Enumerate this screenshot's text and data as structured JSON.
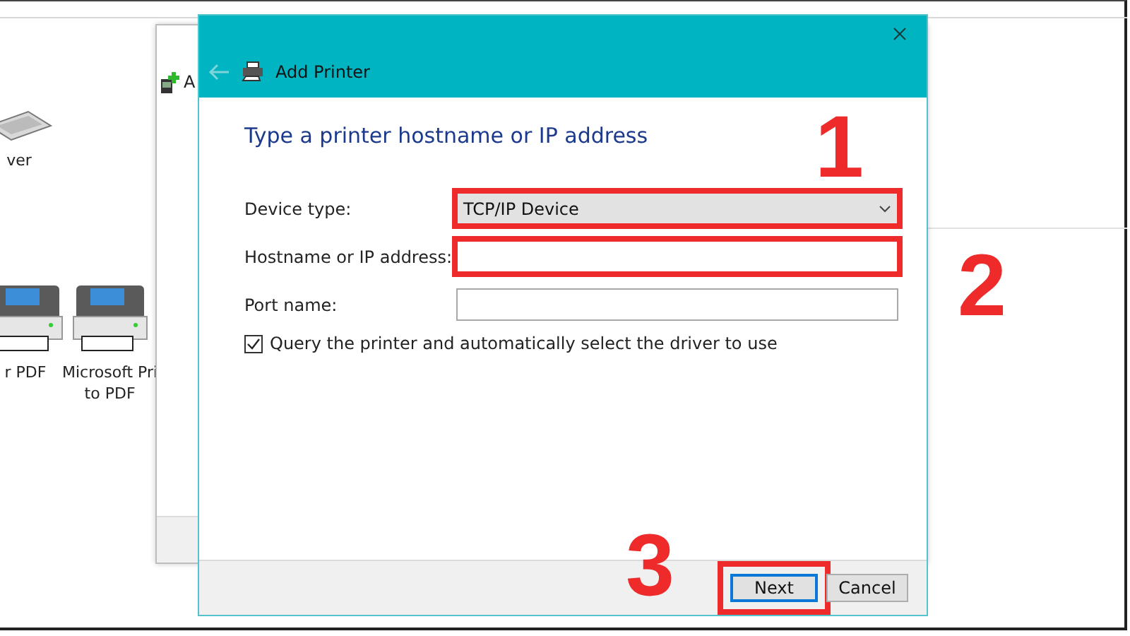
{
  "explorer": {
    "devices": [
      {
        "kind": "keyboard",
        "lines": [
          "ver"
        ]
      },
      {
        "kind": "printer",
        "lines": [
          "r PDF"
        ]
      },
      {
        "kind": "printer",
        "lines": [
          "Microsoft Pri",
          "to PDF"
        ]
      }
    ]
  },
  "back_dialog": {
    "title": "A"
  },
  "dialog": {
    "title": "Add Printer",
    "heading": "Type a printer hostname or IP address",
    "fields": [
      {
        "kind": "dropdown",
        "label": "Device type:",
        "value": "TCP/IP Device",
        "highlighted": true
      },
      {
        "kind": "text",
        "label": "Hostname or IP address:",
        "highlighted": true
      },
      {
        "kind": "text",
        "label": "Port name:",
        "highlighted": false
      }
    ],
    "checkbox": {
      "label": "Query the printer and automatically select the driver to use",
      "checked": true
    },
    "buttons": [
      {
        "label": "Next",
        "kind": "primary",
        "highlighted": true
      },
      {
        "label": "Cancel",
        "kind": "normal",
        "highlighted": false
      }
    ]
  },
  "annotations": [
    {
      "label": "1"
    },
    {
      "label": "2"
    },
    {
      "label": "3"
    }
  ]
}
